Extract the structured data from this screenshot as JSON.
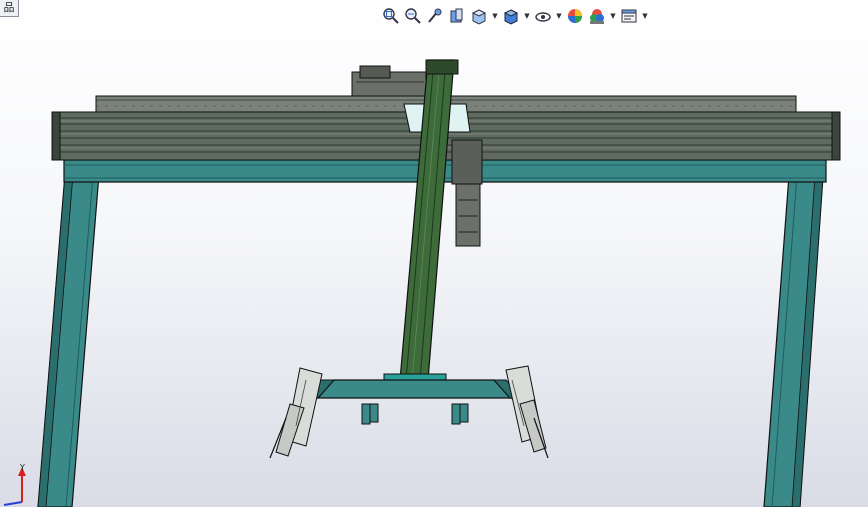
{
  "window": {
    "corner_tab_label": "品"
  },
  "toolbar": {
    "items": [
      {
        "icon": "zoom-to-fit-icon",
        "has_dropdown": false
      },
      {
        "icon": "zoom-to-area-icon",
        "has_dropdown": false
      },
      {
        "icon": "previous-view-icon",
        "has_dropdown": false
      },
      {
        "icon": "section-view-icon",
        "has_dropdown": false
      },
      {
        "icon": "view-orientation-icon",
        "has_dropdown": true
      },
      {
        "icon": "display-style-icon",
        "has_dropdown": true
      },
      {
        "icon": "hide-show-items-icon",
        "has_dropdown": true
      },
      {
        "icon": "edit-appearance-icon",
        "has_dropdown": false
      },
      {
        "icon": "apply-scene-icon",
        "has_dropdown": true
      },
      {
        "icon": "view-settings-icon",
        "has_dropdown": true
      }
    ]
  },
  "model": {
    "description_colors": {
      "frame": "#3a8a8a",
      "frame_dark": "#1f5e5e",
      "rail": "#5f6a60",
      "rail_dark": "#2c3a30",
      "mast": "#3d6b3a",
      "outline": "#111111"
    }
  },
  "triad": {
    "axis_labels": [
      "Y"
    ]
  }
}
